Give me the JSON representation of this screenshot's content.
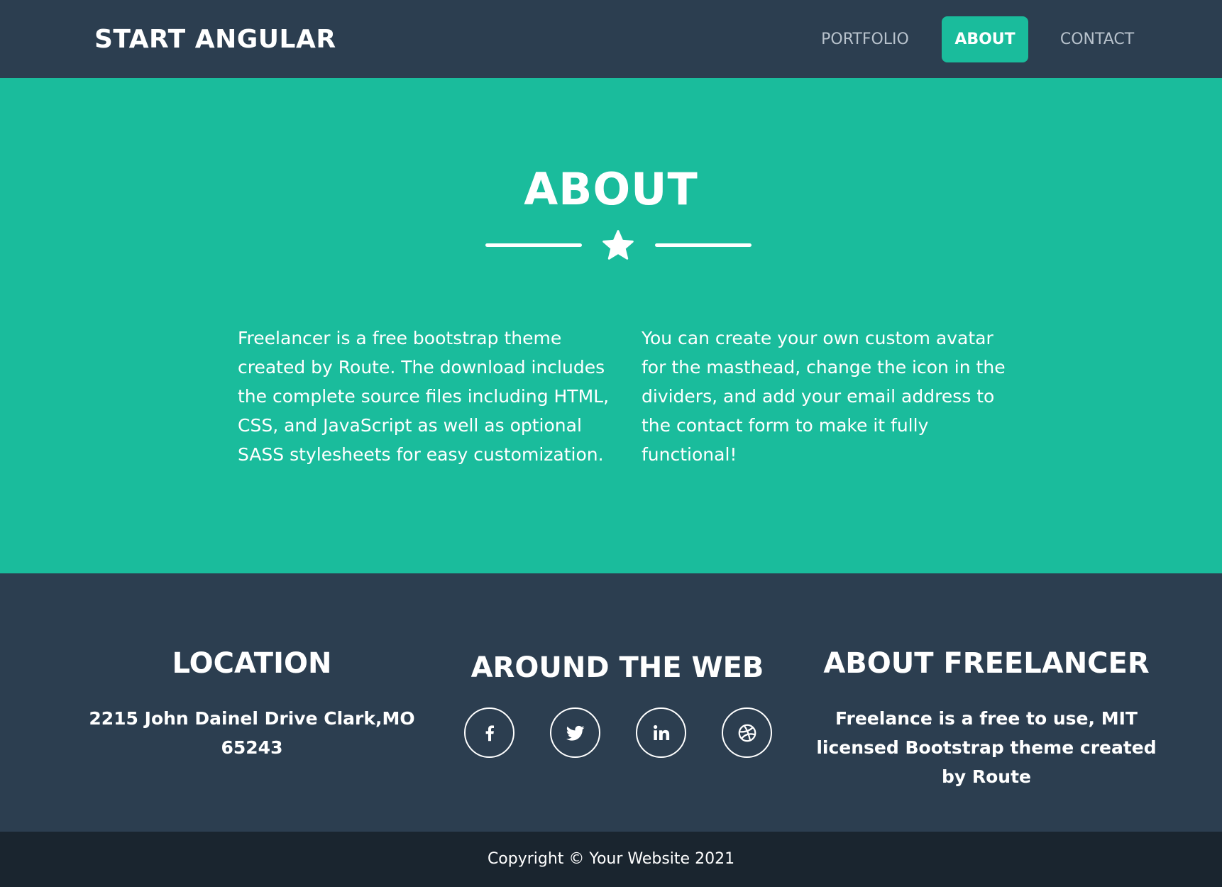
{
  "navbar": {
    "brand": "START ANGULAR",
    "links": [
      {
        "label": "PORTFOLIO",
        "active": false
      },
      {
        "label": "ABOUT",
        "active": true
      },
      {
        "label": "CONTACT",
        "active": false
      }
    ]
  },
  "about": {
    "title": "ABOUT",
    "divider_icon": "star-icon",
    "paragraphs": [
      "Freelancer is a free bootstrap theme created by Route. The download includes the complete source files including HTML, CSS, and JavaScript as well as optional SASS stylesheets for easy customization.",
      "You can create your own custom avatar for the masthead, change the icon in the dividers, and add your email address to the contact form to make it fully functional!"
    ]
  },
  "footer": {
    "location": {
      "heading": "LOCATION",
      "address": "2215 John Dainel Drive Clark,MO 65243"
    },
    "web": {
      "heading": "AROUND THE WEB",
      "social": [
        "facebook-icon",
        "twitter-icon",
        "linkedin-icon",
        "dribbble-icon"
      ]
    },
    "freelancer": {
      "heading": "ABOUT FREELANCER",
      "text": "Freelance is a free to use, MIT licensed Bootstrap theme created by Route"
    }
  },
  "copyright": "Copyright © Your Website 2021",
  "colors": {
    "primary": "#1abc9c",
    "secondary": "#2c3e50",
    "copyright_bg": "#1a252f",
    "nav_link": "#b8c2cc"
  }
}
